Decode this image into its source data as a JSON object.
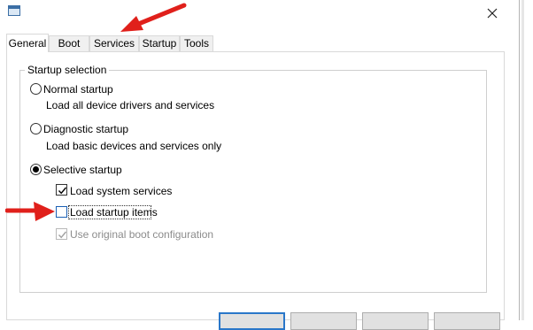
{
  "window": {
    "icon": "msconfig-window-icon",
    "close_icon": "close-icon"
  },
  "tabs": [
    {
      "label": "General",
      "active": true
    },
    {
      "label": "Boot",
      "active": false
    },
    {
      "label": "Services",
      "active": false
    },
    {
      "label": "Startup",
      "active": false
    },
    {
      "label": "Tools",
      "active": false
    }
  ],
  "startup_selection": {
    "title": "Startup selection",
    "normal": {
      "label": "Normal startup",
      "description": "Load all device drivers and services",
      "selected": false
    },
    "diagnostic": {
      "label": "Diagnostic startup",
      "description": "Load basic devices and services only",
      "selected": false
    },
    "selective": {
      "label": "Selective startup",
      "selected": true,
      "options": [
        {
          "label": "Load system services",
          "checked": true,
          "enabled": true
        },
        {
          "label": "Load startup items",
          "checked": false,
          "enabled": true
        },
        {
          "label": "Use original boot configuration",
          "checked": true,
          "enabled": false
        }
      ]
    }
  },
  "annotations": {
    "arrow_color": "#e0201b",
    "arrows": [
      "arrow pointing to Services tab",
      "arrow pointing to Load startup items checkbox"
    ]
  },
  "colors": {
    "focus_border": "#1a5fb4",
    "default_button_border": "#2a77c9",
    "disabled_text": "#8c8c8c"
  }
}
